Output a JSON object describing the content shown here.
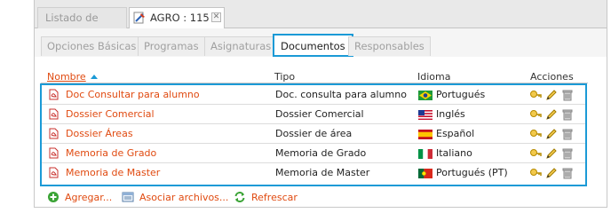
{
  "top_tabs": [
    {
      "label": "Listado de Áreas"
    },
    {
      "label": "AGRO : 115",
      "close_label": "✕"
    }
  ],
  "sub_tabs": [
    {
      "label": "Opciones Básicas"
    },
    {
      "label": "Programas"
    },
    {
      "label": "Asignaturas"
    },
    {
      "label": "Documentos"
    },
    {
      "label": "Responsables"
    }
  ],
  "columns": {
    "nombre": "Nombre",
    "tipo": "Tipo",
    "idioma": "Idioma",
    "acciones": "Acciones"
  },
  "rows": [
    {
      "nombre": "Doc Consultar para alumno",
      "tipo": "Doc. consulta para alumno",
      "idioma": "Portugués",
      "flag": "brazil-flag-icon"
    },
    {
      "nombre": "Dossier Comercial",
      "tipo": "Dossier Comercial",
      "idioma": "Inglés",
      "flag": "usa-flag-icon"
    },
    {
      "nombre": "Dossier Áreas",
      "tipo": "Dossier de área",
      "idioma": "Español",
      "flag": "spain-flag-icon"
    },
    {
      "nombre": "Memoria de Grado",
      "tipo": "Memoria de Grado",
      "idioma": "Italiano",
      "flag": "italy-flag-icon"
    },
    {
      "nombre": "Memoria de Master",
      "tipo": "Memoria de Master",
      "idioma": "Portugués (PT)",
      "flag": "portugal-flag-icon"
    }
  ],
  "toolbar": {
    "add": "Agregar...",
    "attach": "Asociar archivos...",
    "refresh": "Refrescar"
  },
  "colors": {
    "accent_blue": "#1b9ad6",
    "link_orange": "#e04a10"
  }
}
